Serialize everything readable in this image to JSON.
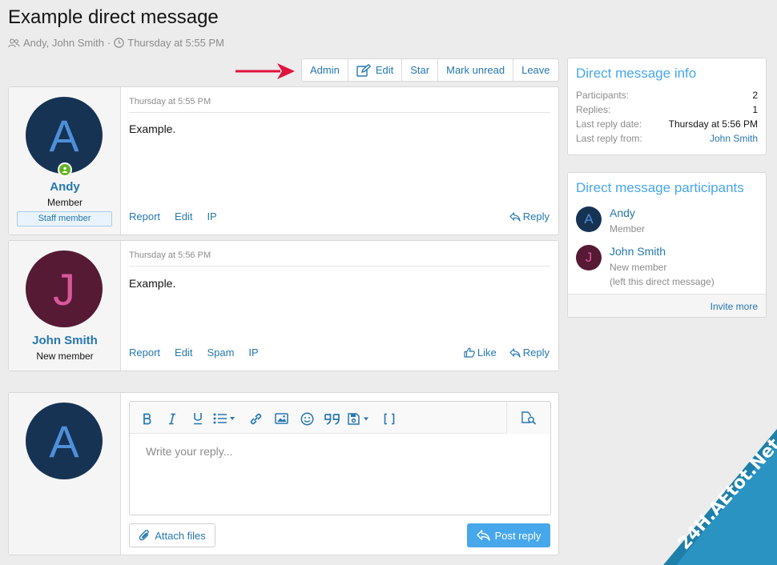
{
  "page": {
    "title": "Example direct message",
    "participants_line": "Andy, John Smith",
    "separator": "·",
    "date_line": "Thursday at 5:55 PM"
  },
  "toolbar": {
    "admin": "Admin",
    "edit": "Edit",
    "star": "Star",
    "mark_unread": "Mark unread",
    "leave": "Leave"
  },
  "messages": [
    {
      "avatar_letter": "A",
      "username": "Andy",
      "user_title": "Member",
      "banner": "Staff member",
      "date": "Thursday at 5:55 PM",
      "body": "Example.",
      "actions": [
        "Report",
        "Edit",
        "IP"
      ],
      "right_actions": [
        "Reply"
      ]
    },
    {
      "avatar_letter": "J",
      "username": "John Smith",
      "user_title": "New member",
      "date": "Thursday at 5:56 PM",
      "body": "Example.",
      "actions": [
        "Report",
        "Edit",
        "Spam",
        "IP"
      ],
      "right_actions": [
        "Like",
        "Reply"
      ]
    }
  ],
  "info": {
    "title": "Direct message info",
    "rows": [
      {
        "label": "Participants:",
        "value": "2"
      },
      {
        "label": "Replies:",
        "value": "1"
      },
      {
        "label": "Last reply date:",
        "value": "Thursday at 5:56 PM"
      },
      {
        "label": "Last reply from:",
        "value": "John Smith"
      }
    ]
  },
  "participants_box": {
    "title": "Direct message participants",
    "items": [
      {
        "letter": "A",
        "name": "Andy",
        "sub": "Member",
        "sub2": ""
      },
      {
        "letter": "J",
        "name": "John Smith",
        "sub": "New member",
        "sub2": "(left this direct message)"
      }
    ],
    "invite": "Invite more"
  },
  "reply": {
    "avatar_letter": "A",
    "placeholder": "Write your reply...",
    "attach": "Attach files",
    "post": "Post reply"
  },
  "watermark": {
    "text": "24H.AEtot.Net"
  },
  "colors": {
    "link": "#2577b1",
    "accent": "#47a7eb",
    "arrow": "#e0143c",
    "online": "#63b324",
    "avatar_a_bg": "#163354",
    "avatar_j_bg": "#561a35",
    "watermark_bg": "#1e7fa8"
  }
}
